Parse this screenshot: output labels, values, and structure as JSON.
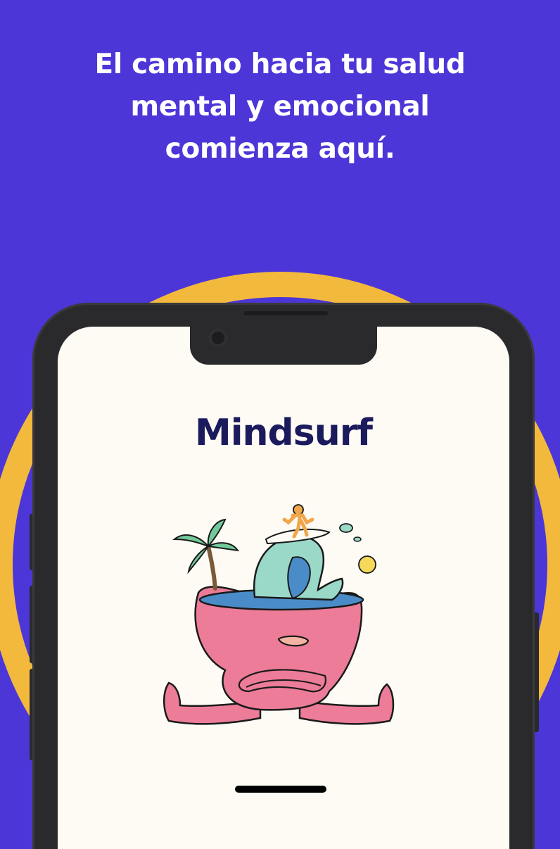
{
  "headline": {
    "line1": "El camino hacia tu salud",
    "line2": "mental y emocional",
    "line3": "comienza aquí."
  },
  "phone_screen": {
    "brand": "Mindsurf",
    "illustration_icon": "surfer-head-character-icon"
  },
  "colors": {
    "background": "#4c36d8",
    "ring": "#f3b93c",
    "phone_frame": "#2a2a2c",
    "screen": "#fdfbf4",
    "brand_text": "#1a1a5c",
    "character_pink": "#ec7c98",
    "wave_teal": "#9ad9c8",
    "wave_blue": "#4a8cc8",
    "sun_yellow": "#f5d95a"
  }
}
